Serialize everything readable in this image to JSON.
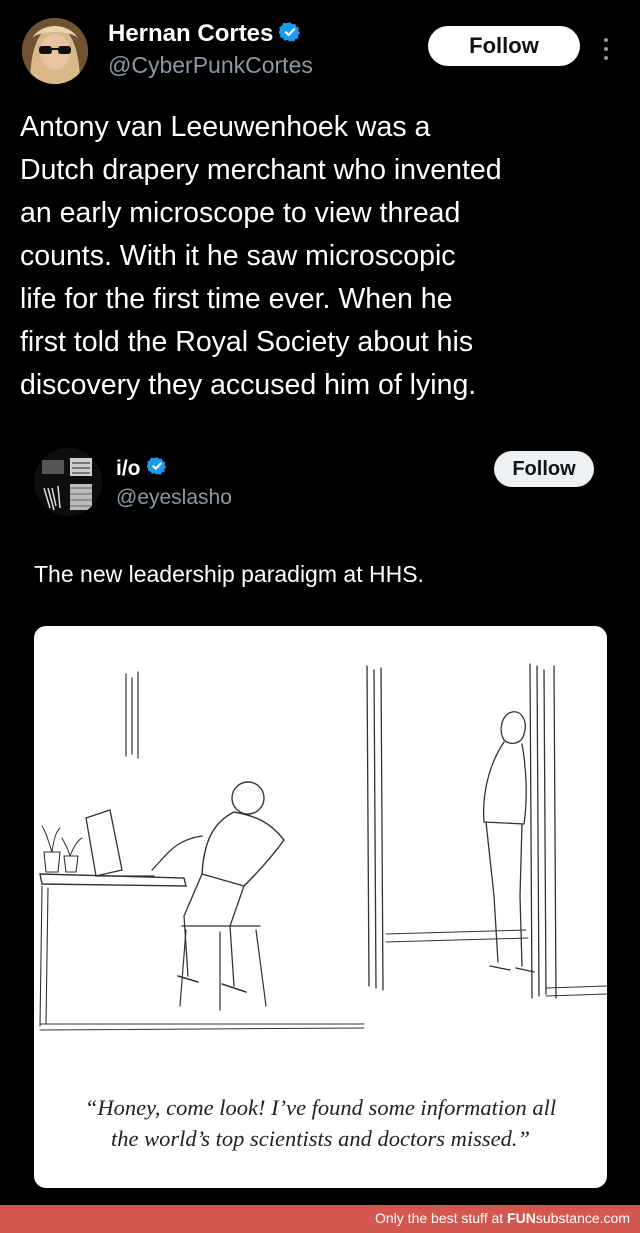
{
  "tweet": {
    "author_name": "Hernan Cortes",
    "author_handle": "@CyberPunkCortes",
    "follow_label": "Follow",
    "text": "Antony van Leeuwenhoek was a\nDutch drapery merchant who invented\nan early microscope to view thread\ncounts. With it he saw microscopic\nlife for the first time ever. When he\nfirst told the Royal Society about his\ndiscovery they accused him of lying."
  },
  "quoted": {
    "author_name": "i/o",
    "author_handle": "@eyeslasho",
    "follow_label": "Follow",
    "text": "The new leadership paradigm at HHS.",
    "cartoon_caption_line1": "“Honey, come look! I’ve found some information all",
    "cartoon_caption_line2": "the world’s top scientists and doctors missed.”"
  },
  "footer": {
    "prefix": "Only the best stuff at ",
    "brand_bold": "FUN",
    "brand_rest": "substance.com"
  },
  "colors": {
    "background": "#000000",
    "verified_badge": "#1d9bf0",
    "handle_gray": "#8b98a5",
    "footer_bar": "#d4574f"
  },
  "icons": [
    "verified-badge-icon",
    "more-options-icon"
  ]
}
